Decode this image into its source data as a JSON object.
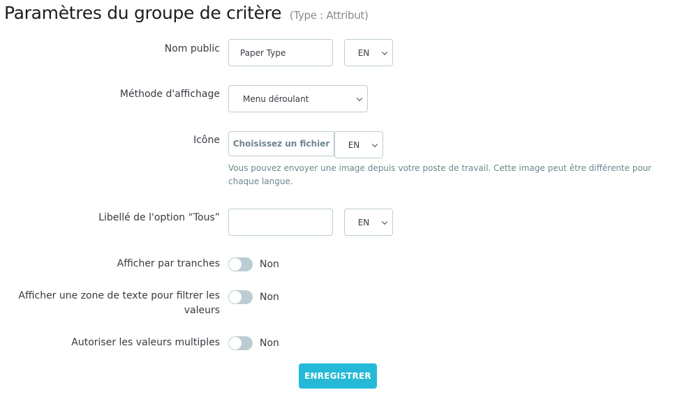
{
  "header": {
    "title": "Paramètres du groupe de critère",
    "subtitle": "(Type : Attribut)"
  },
  "form": {
    "public_name": {
      "label": "Nom public",
      "value": "Paper Type",
      "lang": "EN"
    },
    "display_method": {
      "label": "Méthode d'affichage",
      "value": "Menu déroulant"
    },
    "icon": {
      "label": "Icône",
      "button_label": "Choisissez un fichier",
      "lang": "EN",
      "help": "Vous pouvez envoyer une image depuis votre poste de travail. Cette image peut être différente pour chaque langue."
    },
    "all_option_label": {
      "label": "Libellé de l'option “Tous”",
      "value": "",
      "lang": "EN"
    },
    "show_ranges": {
      "label": "Afficher par tranches",
      "state": "Non"
    },
    "text_filter": {
      "label": "Afficher une zone de texte pour filtrer les valeurs",
      "state": "Non"
    },
    "multiple_values": {
      "label": "Autoriser les valeurs multiples",
      "state": "Non"
    },
    "save_label": "ENREGISTRER"
  },
  "colors": {
    "accent": "#25b9d7",
    "switch_off": "#bbcdd2",
    "border": "#bbcdd2",
    "help_text": "#6c868e"
  }
}
